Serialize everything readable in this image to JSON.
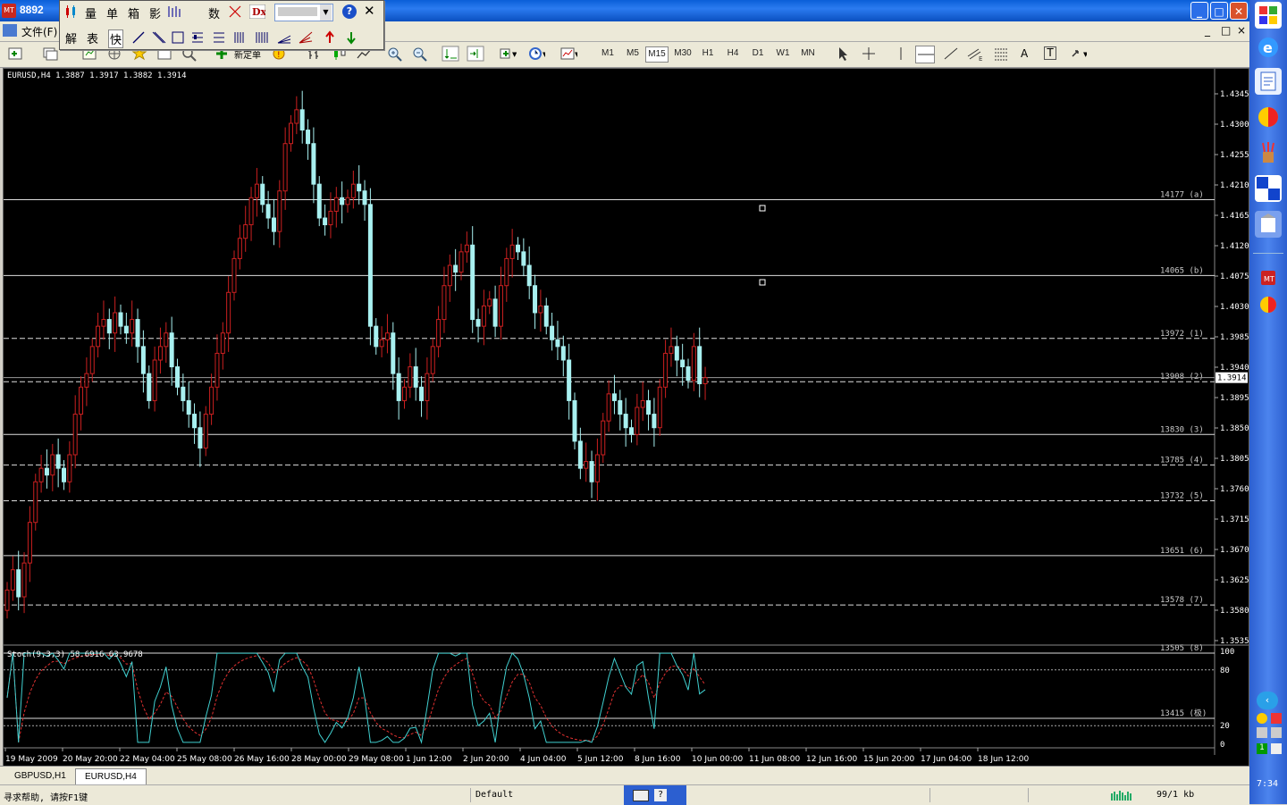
{
  "window": {
    "title": "8892",
    "minimize": "_",
    "maximize": "□",
    "close": "✕"
  },
  "menu": {
    "file": "文件(F)",
    "items_right": [
      "_",
      "□",
      "×"
    ]
  },
  "float_toolbar": {
    "row1": [
      "量",
      "单",
      "箱",
      "影",
      "数"
    ],
    "row2": [
      "解",
      "表",
      "快"
    ],
    "close": "✕",
    "help": "?"
  },
  "toolbar": {
    "new_order": "新定单",
    "timeframes": [
      "M1",
      "M5",
      "M15",
      "M30",
      "H1",
      "H4",
      "D1",
      "W1",
      "MN"
    ],
    "active_timeframe": "M15",
    "text_tool": "A",
    "label_tool": "T"
  },
  "chart": {
    "symbol_info": "EURUSD,H4  1.3887 1.3917 1.3882 1.3914",
    "current_price": "1.3914",
    "stoch_label": "Stoch(9,3,3) 58.6916 63.9678",
    "price_axis": [
      "1.4345",
      "1.4300",
      "1.4255",
      "1.4210",
      "1.4165",
      "1.4120",
      "1.4075",
      "1.4030",
      "1.3985",
      "1.3940",
      "1.3895",
      "1.3850",
      "1.3805",
      "1.3760",
      "1.3715",
      "1.3670",
      "1.3625",
      "1.3580",
      "1.3535"
    ],
    "stoch_axis": [
      "100",
      "80",
      "20",
      "0"
    ],
    "time_axis": [
      "19 May 2009",
      "20 May 20:00",
      "22 May 04:00",
      "25 May 08:00",
      "26 May 16:00",
      "28 May 00:00",
      "29 May 08:00",
      "1 Jun 12:00",
      "2 Jun 20:00",
      "4 Jun 04:00",
      "5 Jun 12:00",
      "8 Jun 16:00",
      "10 Jun 00:00",
      "11 Jun 08:00",
      "12 Jun 16:00",
      "15 Jun 20:00",
      "17 Jun 04:00",
      "18 Jun 12:00"
    ],
    "levels": [
      {
        "label": "14177 (a)",
        "price": 1.4177,
        "dashed": false
      },
      {
        "label": "14065 (b)",
        "price": 1.4065,
        "dashed": false
      },
      {
        "label": "13972 (1)",
        "price": 1.3972,
        "dashed": true
      },
      {
        "label": "13908 (2)",
        "price": 1.3908,
        "dashed": true
      },
      {
        "label": "13830 (3)",
        "price": 1.383,
        "dashed": false
      },
      {
        "label": "13785 (4)",
        "price": 1.3785,
        "dashed": true
      },
      {
        "label": "13732 (5)",
        "price": 1.3732,
        "dashed": true
      },
      {
        "label": "13651 (6)",
        "price": 1.3651,
        "dashed": false
      },
      {
        "label": "13578 (7)",
        "price": 1.3578,
        "dashed": true
      },
      {
        "label": "13505 (8)",
        "price": 1.3505,
        "dashed": false
      },
      {
        "label": "13415 (极)",
        "price": 1.3415,
        "dashed": false
      }
    ],
    "price_range": [
      1.352,
      1.436
    ]
  },
  "chart_data": {
    "type": "candlestick",
    "symbol": "EURUSD",
    "timeframe": "H4",
    "close_series": [
      1.36,
      1.363,
      1.359,
      1.364,
      1.37,
      1.376,
      1.378,
      1.377,
      1.38,
      1.378,
      1.376,
      1.38,
      1.386,
      1.39,
      1.392,
      1.396,
      1.399,
      1.4,
      1.398,
      1.401,
      1.399,
      1.398,
      1.4,
      1.396,
      1.392,
      1.388,
      1.394,
      1.396,
      1.398,
      1.393,
      1.39,
      1.388,
      1.386,
      1.384,
      1.381,
      1.386,
      1.39,
      1.395,
      1.398,
      1.404,
      1.409,
      1.412,
      1.414,
      1.418,
      1.42,
      1.417,
      1.415,
      1.413,
      1.419,
      1.426,
      1.429,
      1.431,
      1.428,
      1.426,
      1.42,
      1.415,
      1.414,
      1.416,
      1.418,
      1.417,
      1.418,
      1.42,
      1.419,
      1.417,
      1.399,
      1.396,
      1.397,
      1.398,
      1.392,
      1.388,
      1.39,
      1.393,
      1.39,
      1.388,
      1.392,
      1.396,
      1.4,
      1.405,
      1.408,
      1.407,
      1.41,
      1.411,
      1.4,
      1.399,
      1.402,
      1.403,
      1.399,
      1.405,
      1.409,
      1.411,
      1.41,
      1.408,
      1.405,
      1.401,
      1.402,
      1.399,
      1.397,
      1.396,
      1.394,
      1.388,
      1.382,
      1.378,
      1.379,
      1.376,
      1.38,
      1.385,
      1.389,
      1.388,
      1.386,
      1.384,
      1.383,
      1.387,
      1.388,
      1.386,
      1.384,
      1.39,
      1.395,
      1.396,
      1.394,
      1.393,
      1.391,
      1.396,
      1.3905,
      1.3914
    ],
    "stoch_main_last": 58.6916,
    "stoch_signal_last": 63.9678,
    "stoch_levels": [
      80,
      20
    ]
  },
  "tabs": [
    "GBPUSD,H1",
    "EURUSD,H4"
  ],
  "active_tab": "EURUSD,H4",
  "status": {
    "help": "寻求帮助, 请按F1键",
    "profile": "Default",
    "traffic": "99/1 kb"
  },
  "sidebar": {
    "clock": "7:34"
  },
  "colors": {
    "bull": "#cc2020",
    "bear": "#a8f0f0",
    "background": "#000000",
    "stoch_main": "#40d0d0",
    "stoch_signal": "#e03030"
  }
}
